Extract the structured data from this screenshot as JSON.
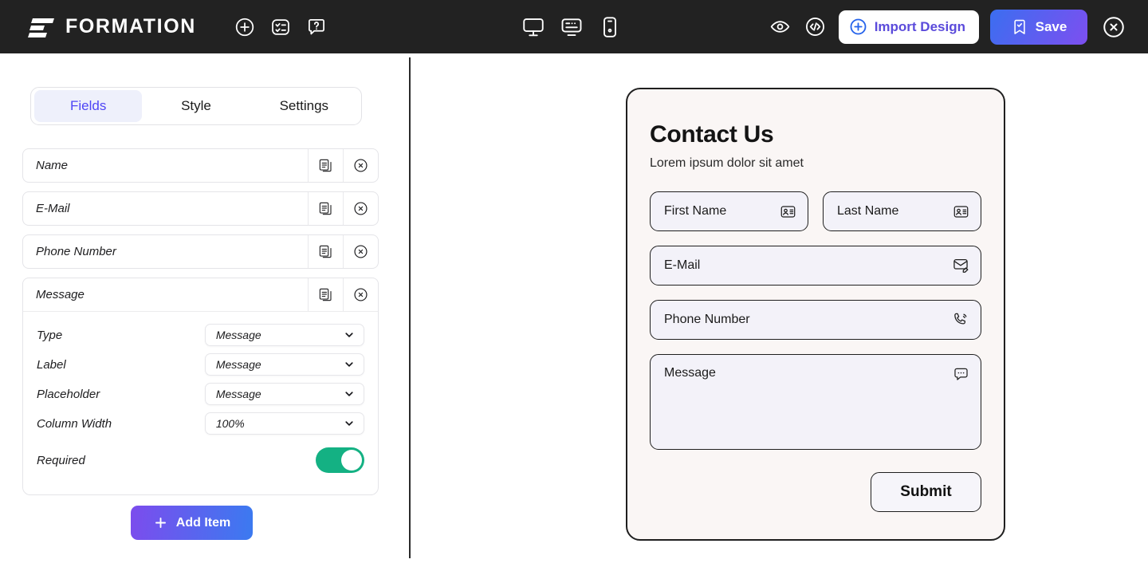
{
  "header": {
    "brand": "FORMATION",
    "brand_icon": "formation-logo-icon",
    "left_icons": [
      {
        "name": "plus-circle-icon",
        "title": "Add"
      },
      {
        "name": "form-list-icon",
        "title": "Forms"
      },
      {
        "name": "help-chat-icon",
        "title": "Help"
      }
    ],
    "device_icons": [
      {
        "name": "desktop-icon",
        "title": "Desktop"
      },
      {
        "name": "tablet-icon",
        "title": "Tablet"
      },
      {
        "name": "mobile-icon",
        "title": "Mobile"
      }
    ],
    "right_icons": [
      {
        "name": "preview-eye-icon",
        "title": "Preview"
      },
      {
        "name": "code-icon",
        "title": "Code"
      }
    ],
    "import_label": "Import Design",
    "import_icon": "plus-circle-icon",
    "save_label": "Save",
    "save_icon": "bookmark-check-icon",
    "close_icon": "close-circle-icon",
    "bg_color": "#222222",
    "save_gradient_from": "#3b6ef0",
    "save_gradient_to": "#7d4ff0",
    "import_text_color": "#5b4bdb"
  },
  "editor": {
    "tabs": [
      {
        "label": "Fields",
        "active": true
      },
      {
        "label": "Style",
        "active": false
      },
      {
        "label": "Settings",
        "active": false
      }
    ],
    "active_tab_color": "#4f46f5",
    "fields": [
      {
        "name": "Name"
      },
      {
        "name": "E-Mail"
      },
      {
        "name": "Phone Number"
      },
      {
        "name": "Message"
      }
    ],
    "row_icons": {
      "duplicate": "duplicate-icon",
      "delete": "close-circle-icon"
    },
    "selected_field_settings": {
      "type": {
        "label": "Type",
        "value": "Message"
      },
      "field_label": {
        "label": "Label",
        "value": "Message"
      },
      "placeholder": {
        "label": "Placeholder",
        "value": "Message"
      },
      "column_width": {
        "label": "Column Width",
        "value": "100%"
      },
      "required": {
        "label": "Required",
        "value": "on"
      }
    },
    "toggle_on_color": "#14b183",
    "add_item_label": "Add Item",
    "add_item_icon": "plus-icon"
  },
  "preview": {
    "title": "Contact Us",
    "subtitle": "Lorem ipsum dolor sit amet",
    "card_bg": "#faf6f5",
    "input_bg": "#f3f2f9",
    "fields": [
      {
        "placeholder": "First Name",
        "icon": "contact-card-icon",
        "width": "half"
      },
      {
        "placeholder": "Last Name",
        "icon": "contact-card-icon",
        "width": "half"
      },
      {
        "placeholder": "E-Mail",
        "icon": "mail-edit-icon",
        "width": "full"
      },
      {
        "placeholder": "Phone Number",
        "icon": "phone-ring-icon",
        "width": "full"
      },
      {
        "placeholder": "Message",
        "icon": "chat-dots-icon",
        "width": "full",
        "multiline": true
      }
    ],
    "submit_label": "Submit"
  }
}
